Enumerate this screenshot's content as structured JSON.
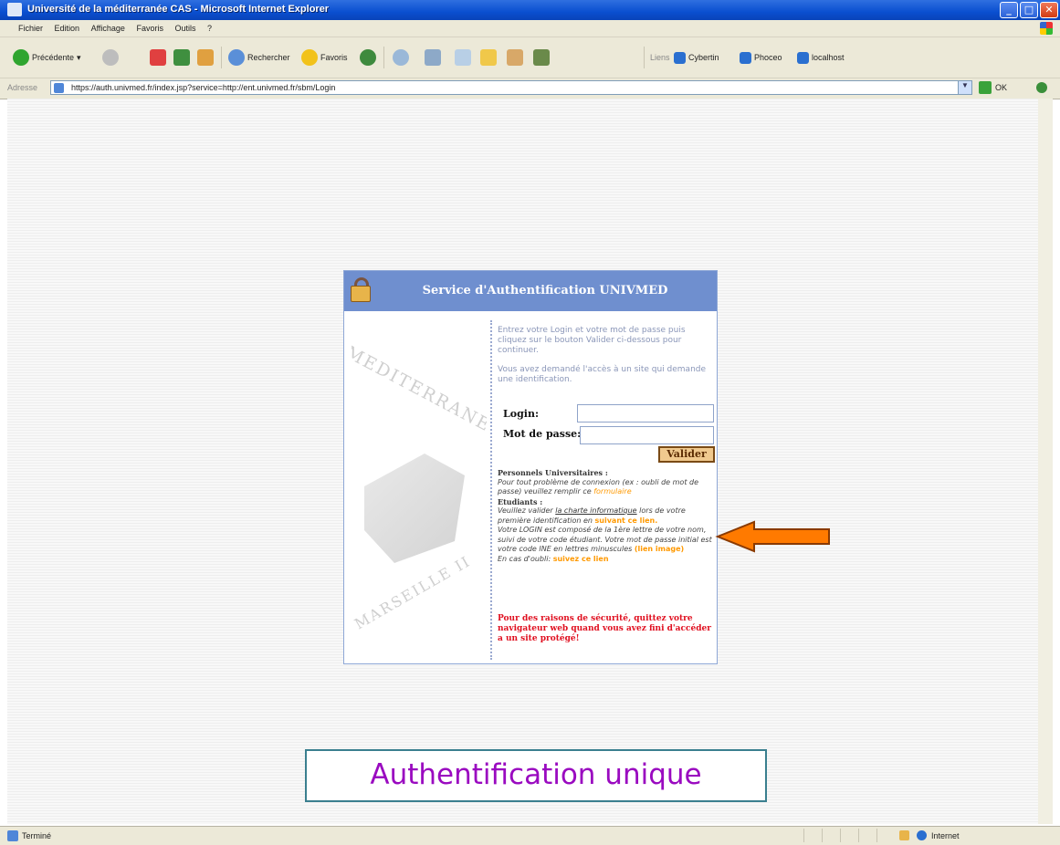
{
  "window": {
    "title": "Université de la méditerranée CAS - Microsoft Internet Explorer",
    "minimize_glyph": "_",
    "maximize_glyph": "□",
    "close_glyph": "✕"
  },
  "menubar": {
    "items": [
      "Fichier",
      "Edition",
      "Affichage",
      "Favoris",
      "Outils",
      "?"
    ]
  },
  "toolbar": {
    "back_label": "Précédente",
    "search_label": "Rechercher",
    "favorites_label": "Favoris",
    "links": [
      "Liens",
      "Cybertin",
      "Phoceo",
      "localhost"
    ]
  },
  "addressbar": {
    "label": "Adresse",
    "url": "https://auth.univmed.fr/index.jsp?service=http://ent.univmed.fr/sbm/Login",
    "go_label": "OK"
  },
  "login": {
    "title": "Service d'Authentification UNIVMED",
    "intro_1": "Entrez votre Login et votre mot de passe puis cliquez sur le bouton Valider ci-dessous pour continuer.",
    "intro_2": "Vous avez demandé l'accès à un site qui demande une identification.",
    "login_label": "Login:",
    "password_label": "Mot de passe:",
    "submit_label": "Valider",
    "watermark_1": "MEDITERRANEE",
    "watermark_2": "MARSEILLE II",
    "info": {
      "staff_heading": "Personnels Universitaires :",
      "staff_text": "Pour tout problème de connexion (ex : oubli de mot de passe) veuillez remplir ce",
      "staff_link": "formulaire",
      "students_heading": "Etudiants :",
      "students_text_1": "Veuillez valider",
      "charter_link": "la charte informatique",
      "students_text_2": "lors de votre première identification en",
      "follow_link": "suivant ce lien.",
      "students_text_3": "Votre LOGIN est composé de la 1ère lettre de votre nom, suivi de votre code étudiant. Votre mot de passe initial est votre code INE en lettres minuscules",
      "image_link": "(lien image)",
      "forgot_text": "En cas d'oubli:",
      "forgot_link": "suivez ce lien"
    },
    "warning": "Pour des raisons de sécurité, quittez votre navigateur web quand vous avez fini d'accéder a un site protégé!"
  },
  "caption": "Authentification unique",
  "statusbar": {
    "text": "Terminé",
    "zone": "Internet"
  },
  "colors": {
    "titlebar": "#0a4fd0",
    "login_header": "#6f8fcf",
    "arrow": "#ff7a00",
    "caption_text": "#9a0ac0",
    "warning": "#e01020"
  }
}
